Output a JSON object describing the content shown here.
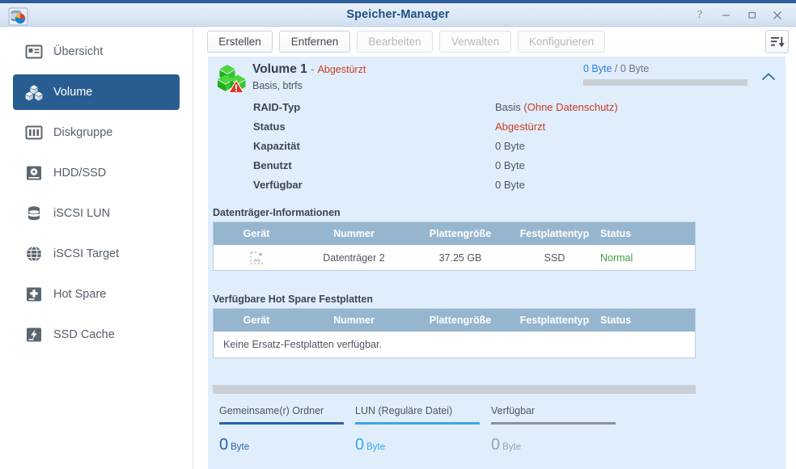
{
  "window": {
    "title": "Speicher-Manager",
    "app_icon": "storage-manager-icon",
    "controls": {
      "help": "?",
      "minimize": "minimize-icon",
      "maximize": "maximize-icon",
      "close": "close-icon"
    }
  },
  "sidebar": {
    "items": [
      {
        "label": "Übersicht",
        "icon": "overview-icon",
        "active": false
      },
      {
        "label": "Volume",
        "icon": "volume-icon",
        "active": true
      },
      {
        "label": "Diskgruppe",
        "icon": "diskgroup-icon",
        "active": false
      },
      {
        "label": "HDD/SSD",
        "icon": "hdd-ssd-icon",
        "active": false
      },
      {
        "label": "iSCSI LUN",
        "icon": "iscsi-lun-icon",
        "active": false
      },
      {
        "label": "iSCSI Target",
        "icon": "iscsi-target-icon",
        "active": false
      },
      {
        "label": "Hot Spare",
        "icon": "hot-spare-icon",
        "active": false
      },
      {
        "label": "SSD Cache",
        "icon": "ssd-cache-icon",
        "active": false
      }
    ]
  },
  "toolbar": {
    "buttons": [
      {
        "label": "Erstellen",
        "enabled": true
      },
      {
        "label": "Entfernen",
        "enabled": true
      },
      {
        "label": "Bearbeiten",
        "enabled": false
      },
      {
        "label": "Verwalten",
        "enabled": false
      },
      {
        "label": "Konfigurieren",
        "enabled": false
      }
    ],
    "sort_icon": "sort-descending-icon"
  },
  "volume": {
    "name": "Volume 1",
    "separator": "-",
    "state": "Abgestürzt",
    "subtitle": "Basis, btrfs",
    "usage_used": "0 Byte",
    "usage_divider": "/",
    "usage_total": "0 Byte",
    "usage_percent": 0,
    "collapse_icon": "chevron-up-icon",
    "status_icon": "volume-crashed-icon",
    "info": [
      {
        "label": "RAID-Typ",
        "value": "Basis ",
        "value_note": "(Ohne Datenschutz)",
        "note_color": "#cc3b25"
      },
      {
        "label": "Status",
        "value": "Abgestürzt",
        "value_note": "",
        "note_color": "#cc3b25"
      },
      {
        "label": "Kapazität",
        "value": "0 Byte",
        "value_note": "",
        "note_color": ""
      },
      {
        "label": "Benutzt",
        "value": "0 Byte",
        "value_note": "",
        "note_color": ""
      },
      {
        "label": "Verfügbar",
        "value": "0 Byte",
        "value_note": "",
        "note_color": ""
      }
    ]
  },
  "disk_table": {
    "title": "Datenträger-Informationen",
    "columns": [
      "Gerät",
      "Nummer",
      "Plattengröße",
      "Festplattentyp",
      "Status"
    ],
    "rows": [
      {
        "geraet_icon": "broken-image-icon",
        "nummer": "Datenträger 2",
        "groesse": "37.25 GB",
        "typ": "SSD",
        "status": "Normal"
      }
    ]
  },
  "hotspare_table": {
    "title": "Verfügbare Hot Spare Festplatten",
    "columns": [
      "Gerät",
      "Nummer",
      "Plattengröße",
      "Festplattentyp",
      "Status"
    ],
    "empty_text": "Keine Ersatz-Festplatten verfügbar."
  },
  "summary": {
    "columns": [
      {
        "label": "Gemeinsame(r) Ordner",
        "value": "0",
        "unit": "Byte",
        "color": "#2764ab",
        "rule_color": "#2764ab"
      },
      {
        "label": "LUN (Reguläre Datei)",
        "value": "0",
        "unit": "Byte",
        "color": "#3ba6e8",
        "rule_color": "#3ba6e8"
      },
      {
        "label": "Verfügbar",
        "value": "0",
        "unit": "Byte",
        "color": "#9aa3ab",
        "rule_color": "#8a9299"
      }
    ]
  },
  "colors": {
    "accent": "#295d92",
    "panel_bg": "#e0edfb",
    "table_header": "#96b6cf",
    "error": "#cc3b25",
    "ok": "#3f9e3f"
  }
}
